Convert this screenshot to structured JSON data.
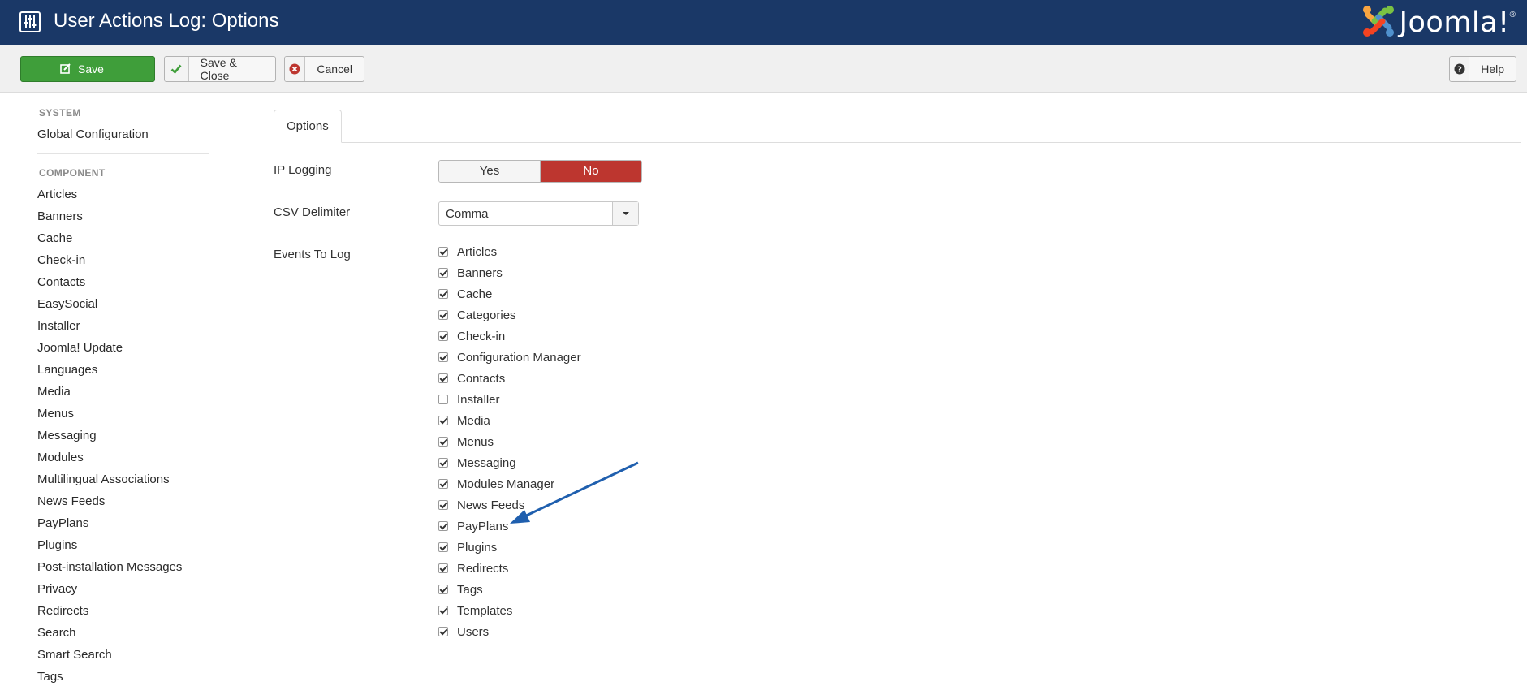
{
  "header": {
    "title": "User Actions Log: Options",
    "brand": "Joomla!",
    "brand_mark": "®",
    "bg_color": "#1a3867"
  },
  "toolbar": {
    "save_label": "Save",
    "save_close_label": "Save & Close",
    "cancel_label": "Cancel",
    "help_label": "Help"
  },
  "sidebar": {
    "system_heading": "SYSTEM",
    "system_items": [
      "Global Configuration"
    ],
    "component_heading": "COMPONENT",
    "component_items": [
      "Articles",
      "Banners",
      "Cache",
      "Check-in",
      "Contacts",
      "EasySocial",
      "Installer",
      "Joomla! Update",
      "Languages",
      "Media",
      "Menus",
      "Messaging",
      "Modules",
      "Multilingual Associations",
      "News Feeds",
      "PayPlans",
      "Plugins",
      "Post-installation Messages",
      "Privacy",
      "Redirects",
      "Search",
      "Smart Search",
      "Tags"
    ]
  },
  "main": {
    "tab_label": "Options",
    "ip_logging": {
      "label": "IP Logging",
      "yes": "Yes",
      "no": "No",
      "selected": "No"
    },
    "csv_delimiter": {
      "label": "CSV Delimiter",
      "value": "Comma"
    },
    "events": {
      "label": "Events To Log",
      "items": [
        {
          "label": "Articles",
          "checked": true
        },
        {
          "label": "Banners",
          "checked": true
        },
        {
          "label": "Cache",
          "checked": true
        },
        {
          "label": "Categories",
          "checked": true
        },
        {
          "label": "Check-in",
          "checked": true
        },
        {
          "label": "Configuration Manager",
          "checked": true
        },
        {
          "label": "Contacts",
          "checked": true
        },
        {
          "label": "Installer",
          "checked": false
        },
        {
          "label": "Media",
          "checked": true
        },
        {
          "label": "Menus",
          "checked": true
        },
        {
          "label": "Messaging",
          "checked": true
        },
        {
          "label": "Modules Manager",
          "checked": true
        },
        {
          "label": "News Feeds",
          "checked": true
        },
        {
          "label": "PayPlans",
          "checked": true
        },
        {
          "label": "Plugins",
          "checked": true
        },
        {
          "label": "Redirects",
          "checked": true
        },
        {
          "label": "Tags",
          "checked": true
        },
        {
          "label": "Templates",
          "checked": true
        },
        {
          "label": "Users",
          "checked": true
        }
      ]
    }
  },
  "colors": {
    "save_green": "#3f9e3a",
    "no_red": "#bd362f",
    "arrow_blue": "#1f5fae"
  }
}
